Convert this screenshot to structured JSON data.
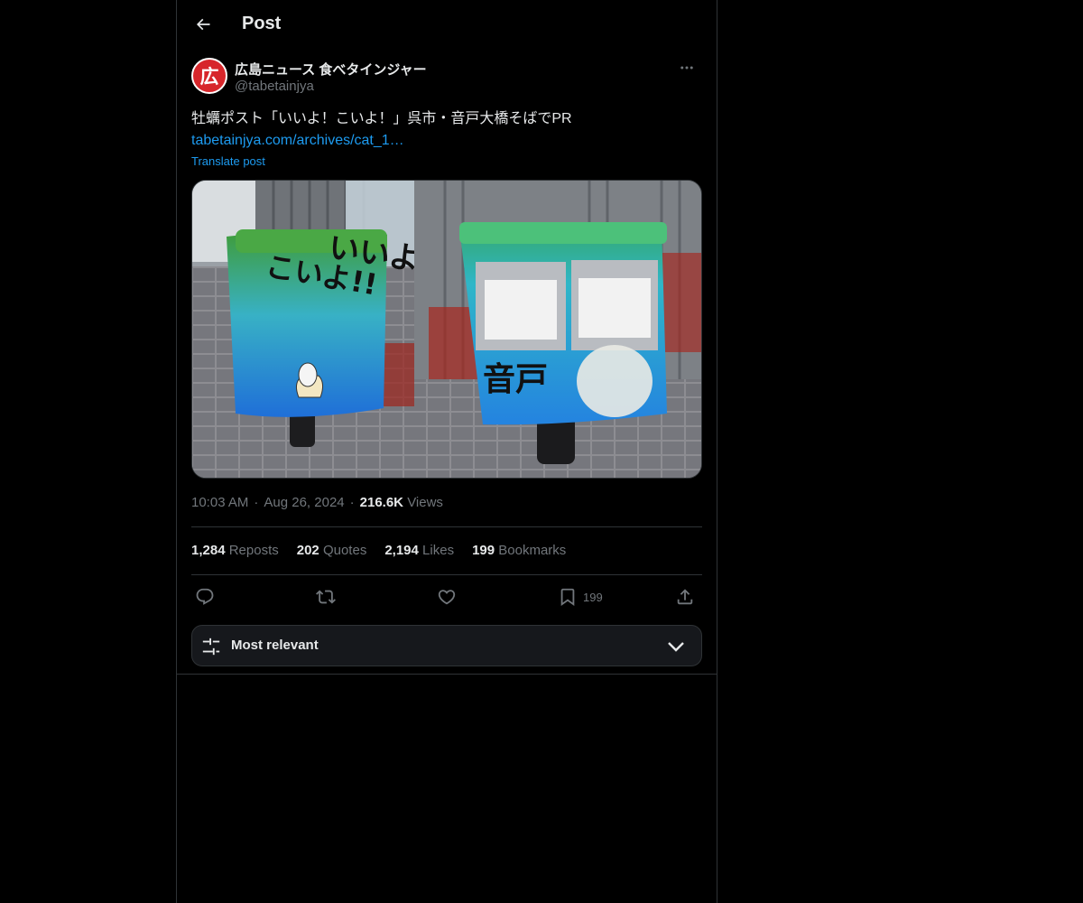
{
  "header": {
    "title": "Post"
  },
  "author": {
    "avatar_text": "広",
    "display_name": "広島ニュース 食べタインジャー",
    "handle": "@tabetainjya"
  },
  "tweet": {
    "text": "牡蠣ポスト「いいよ！こいよ！」呉市・音戸大橋そばでPR",
    "link": "tabetainjya.com/archives/cat_1…",
    "translate_label": "Translate post"
  },
  "media": {
    "left_box_text_1": "いいよ!!",
    "left_box_text_2": "こいよ!!",
    "right_box_text": "音戸"
  },
  "meta": {
    "time": "10:03 AM",
    "date": "Aug 26, 2024",
    "views_count": "216.6K",
    "views_label": "Views"
  },
  "stats": {
    "reposts_count": "1,284",
    "reposts_label": "Reposts",
    "quotes_count": "202",
    "quotes_label": "Quotes",
    "likes_count": "2,194",
    "likes_label": "Likes",
    "bookmarks_count": "199",
    "bookmarks_label": "Bookmarks"
  },
  "actions": {
    "bookmark_count": "199"
  },
  "sort": {
    "label": "Most relevant"
  },
  "colors": {
    "background": "#000000",
    "accent": "#1d9bf0",
    "text": "#e7e9ea",
    "muted": "#71767b",
    "border": "#2f3336"
  },
  "icons": [
    "back-arrow-icon",
    "more-icon",
    "reply-icon",
    "repost-icon",
    "like-icon",
    "bookmark-icon",
    "share-icon",
    "sliders-icon",
    "chevron-down-icon"
  ]
}
